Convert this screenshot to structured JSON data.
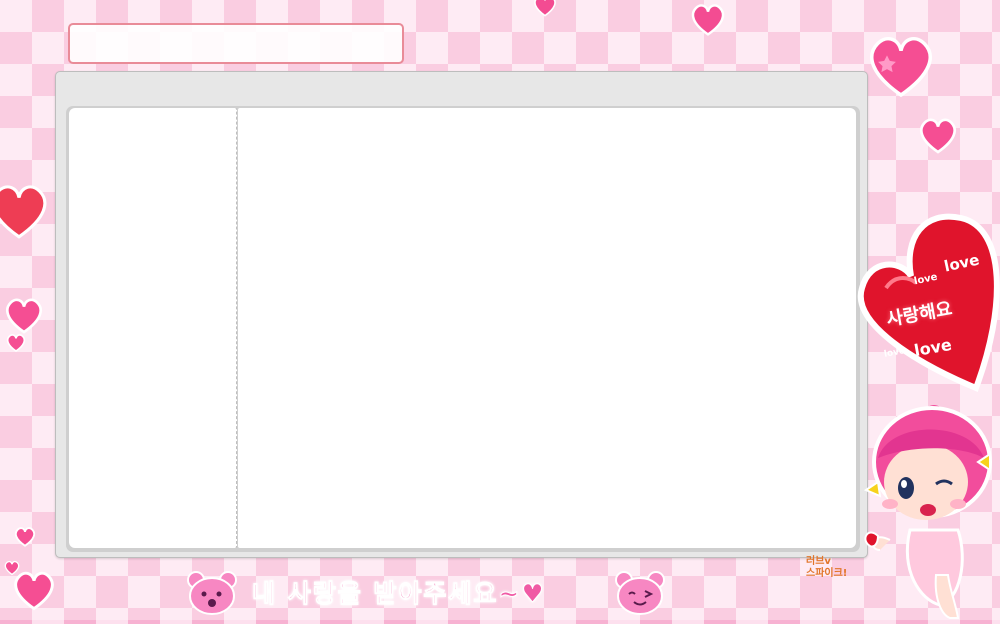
{
  "banner": {
    "message": "내 사랑을 받아주세요~♥"
  },
  "sticker": {
    "line_main": "사랑해요",
    "love_words": [
      "love",
      "love",
      "love",
      "love"
    ]
  },
  "signature": {
    "line1": "러브v",
    "line2": "스파이크!"
  },
  "colors": {
    "pink_check": "#f7b2d2",
    "title_border": "#e98b98",
    "heart_red": "#e0142c",
    "heart_pink": "#ff4f9a"
  },
  "icons": [
    "heart-icon",
    "star-icon",
    "bear-face-icon",
    "girl-character-icon"
  ]
}
